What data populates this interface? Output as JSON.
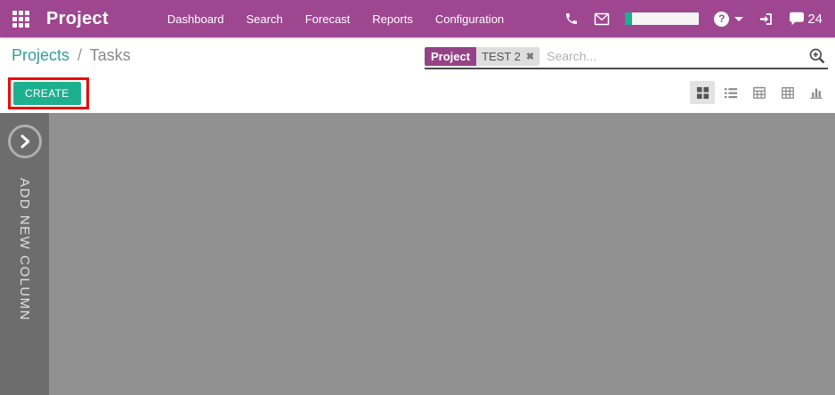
{
  "colors": {
    "navbar_bg": "#9E4690",
    "accent_teal": "#1CB08E",
    "breadcrumb_link": "#33A095",
    "annotation_red": "#E80B0B",
    "content_bg": "#919191",
    "rail_bg": "#6D6D6D"
  },
  "navbar": {
    "app_name": "Project",
    "menu": [
      "Dashboard",
      "Search",
      "Forecast",
      "Reports",
      "Configuration"
    ],
    "help_symbol": "?",
    "message_count": "24"
  },
  "breadcrumb": {
    "link": "Projects",
    "separator": "/",
    "current": "Tasks"
  },
  "search": {
    "facet_label": "Project",
    "facet_value": "TEST 2",
    "facet_remove": "✖",
    "placeholder": "Search..."
  },
  "control_panel": {
    "create_label": "CREATE"
  },
  "view_switcher": {
    "buttons": [
      "kanban",
      "list",
      "calendar",
      "pivot",
      "graph"
    ],
    "active": "kanban"
  },
  "kanban": {
    "add_new_column": "ADD NEW COLUMN"
  },
  "icons": [
    "apps-grid-icon",
    "phone-icon",
    "envelope-icon",
    "timer-indicator",
    "help-icon",
    "caret-down-icon",
    "sign-in-icon",
    "comment-icon",
    "zoom-in-icon",
    "kanban-view-icon",
    "list-view-icon",
    "calendar-view-icon",
    "pivot-view-icon",
    "graph-view-icon",
    "facet-remove-icon",
    "expand-arrow-icon"
  ]
}
